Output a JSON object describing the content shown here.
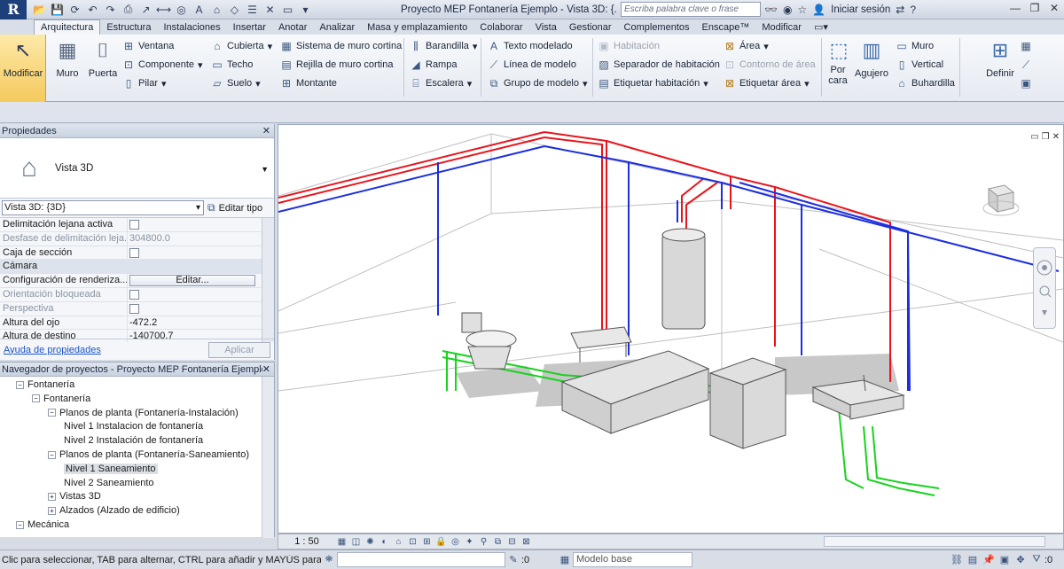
{
  "app": {
    "logo_letter": "R",
    "title": "Proyecto MEP Fontanería Ejemplo - Vista 3D: {...",
    "search_placeholder": "Escriba palabra clave o frase",
    "signin": "Iniciar sesión"
  },
  "tabs": [
    "Arquitectura",
    "Estructura",
    "Instalaciones",
    "Insertar",
    "Anotar",
    "Analizar",
    "Masa y emplazamiento",
    "Colaborar",
    "Vista",
    "Gestionar",
    "Complementos",
    "Enscape™",
    "Modificar"
  ],
  "ribbon": {
    "modificar": "Modificar",
    "muro": "Muro",
    "puerta": "Puerta",
    "ventana": "Ventana",
    "componente": "Componente",
    "pilar": "Pilar",
    "cubierta": "Cubierta",
    "techo": "Techo",
    "suelo": "Suelo",
    "sistema_muro_cortina": "Sistema de muro cortina",
    "rejilla_muro_cortina": "Rejilla de muro cortina",
    "montante": "Montante",
    "barandilla": "Barandilla",
    "rampa": "Rampa",
    "escalera": "Escalera",
    "texto_modelado": "Texto modelado",
    "linea_modelo": "Línea de modelo",
    "grupo_modelo": "Grupo de modelo",
    "habitacion": "Habitación",
    "separador_habitacion": "Separador de habitación",
    "etiquetar_habitacion": "Etiquetar habitación",
    "area": "Área",
    "contorno_area": "Contorno de área",
    "etiquetar_area": "Etiquetar área",
    "por_cara_1": "Por",
    "por_cara_2": "cara",
    "agujero": "Agujero",
    "muro_small": "Muro",
    "vertical": "Vertical",
    "buhardilla": "Buhardilla",
    "definir": "Definir"
  },
  "properties": {
    "header": "Propiedades",
    "type_name": "Vista 3D",
    "view_selector": "Vista 3D: {3D}",
    "edit_type": "Editar tipo",
    "rows": [
      {
        "k": "Delimitación lejana activa",
        "v": "",
        "cb": true,
        "dim": false
      },
      {
        "k": "Desfase de delimitación leja...",
        "v": "304800.0",
        "cb": false,
        "dim": true
      },
      {
        "k": "Caja de sección",
        "v": "",
        "cb": true,
        "dim": false
      }
    ],
    "group_camera": "Cámara",
    "render_config": "Configuración de renderiza...",
    "edit_button": "Editar...",
    "rows2": [
      {
        "k": "Orientación bloqueada",
        "v": "",
        "cb": true,
        "dim": true
      },
      {
        "k": "Perspectiva",
        "v": "",
        "cb": true,
        "dim": true
      },
      {
        "k": "Altura del ojo",
        "v": "-472.2",
        "cb": false,
        "dim": false
      },
      {
        "k": "Altura de destino",
        "v": "-140700.7",
        "cb": false,
        "dim": false
      }
    ],
    "help_link": "Ayuda de propiedades",
    "apply": "Aplicar"
  },
  "browser": {
    "header": "Navegador de proyectos - Proyecto MEP Fontanería Ejemplo",
    "nodes": [
      {
        "label": "Fontanería",
        "indent": 0,
        "tog": "−"
      },
      {
        "label": "Fontanería",
        "indent": 1,
        "tog": "−"
      },
      {
        "label": "Planos de planta (Fontanería-Instalación)",
        "indent": 2,
        "tog": "−"
      },
      {
        "label": "Nivel 1 Instalacion de fontanería",
        "indent": 3,
        "tog": ""
      },
      {
        "label": "Nivel 2 Instalación de fontanería",
        "indent": 3,
        "tog": ""
      },
      {
        "label": "Planos de planta (Fontanería-Saneamiento)",
        "indent": 2,
        "tog": "−"
      },
      {
        "label": "Nivel 1 Saneamiento",
        "indent": 3,
        "tog": "",
        "sel": true
      },
      {
        "label": "Nivel 2 Saneamiento",
        "indent": 3,
        "tog": ""
      },
      {
        "label": "Vistas 3D",
        "indent": 2,
        "tog": "+"
      },
      {
        "label": "Alzados (Alzado de edificio)",
        "indent": 2,
        "tog": "+"
      },
      {
        "label": "Mecánica",
        "indent": 0,
        "tog": "−"
      }
    ]
  },
  "viewbar": {
    "scale": "1 : 50"
  },
  "status": {
    "text": "Clic para seleccionar, TAB para alternar, CTRL para añadir y MAYÚS para anula",
    "zero1": ":0",
    "model_base": "Modelo base",
    "zero2": ":0"
  },
  "colors": {
    "hot_water": "#e8141c",
    "cold_water": "#1c2ee0",
    "drain": "#18d21e"
  }
}
